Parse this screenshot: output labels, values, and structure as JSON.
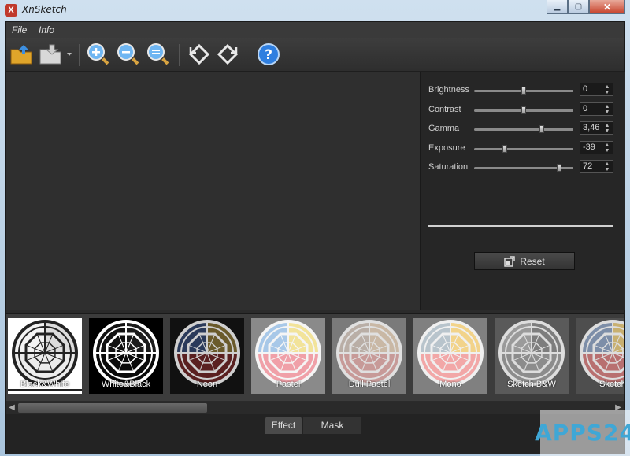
{
  "window": {
    "title": "XnSketch",
    "app_icon": "X"
  },
  "menu": [
    {
      "label": "File"
    },
    {
      "label": "Info"
    }
  ],
  "toolbar": {
    "buttons": [
      {
        "name": "open-icon"
      },
      {
        "name": "save-icon"
      },
      {
        "name": "zoom-in-icon"
      },
      {
        "name": "zoom-out-icon"
      },
      {
        "name": "zoom-fit-icon"
      },
      {
        "name": "rotate-left-icon"
      },
      {
        "name": "rotate-right-icon"
      },
      {
        "name": "help-icon"
      }
    ]
  },
  "adjustments": [
    {
      "label": "Brightness",
      "value": "0",
      "slider": 0.5
    },
    {
      "label": "Contrast",
      "value": "0",
      "slider": 0.5
    },
    {
      "label": "Gamma",
      "value": "3,46",
      "slider": 0.68
    },
    {
      "label": "Exposure",
      "value": "-39",
      "slider": 0.31
    },
    {
      "label": "Saturation",
      "value": "72",
      "slider": 0.86
    }
  ],
  "reset_label": "Reset",
  "effects": [
    {
      "label": "Black&White",
      "bg": "#ffffff",
      "ring": "#222222",
      "q1": "#f2f2f2",
      "q2": "#dcdcdc",
      "q3": "#ececec",
      "selected": true
    },
    {
      "label": "White&Black",
      "bg": "#000000",
      "ring": "#ffffff",
      "q1": "#111111",
      "q2": "#1c1c1c",
      "q3": "#0a0a0a"
    },
    {
      "label": "Neon",
      "bg": "#111111",
      "ring": "#cfcfcf",
      "q1": "#2a3a5a",
      "q2": "#6a5a2a",
      "q3": "#5a2020"
    },
    {
      "label": "Pastel",
      "bg": "#8a8a8a",
      "ring": "#f5f5f5",
      "q1": "#a8c8e8",
      "q2": "#f2e39a",
      "q3": "#f0a0a8"
    },
    {
      "label": "Dull Pastel",
      "bg": "#7a7a7a",
      "ring": "#e0e0e0",
      "q1": "#b9aea6",
      "q2": "#c9b8a5",
      "q3": "#c79a98"
    },
    {
      "label": "Mono",
      "bg": "#808080",
      "ring": "#f0f0f0",
      "q1": "#b8c4cc",
      "q2": "#f2d38a",
      "q3": "#f2a7a7"
    },
    {
      "label": "Sketch B&W",
      "bg": "#5a5a5a",
      "ring": "#dddddd",
      "q1": "#9a9a9a",
      "q2": "#7d7d7d",
      "q3": "#8c8c8c"
    },
    {
      "label": "Sketch",
      "bg": "#4e4e4e",
      "ring": "#dddddd",
      "q1": "#7d8ea8",
      "q2": "#c8b070",
      "q3": "#b87070"
    }
  ],
  "tabs": [
    {
      "label": "Effect",
      "active": true
    },
    {
      "label": "Mask",
      "active": false
    }
  ],
  "watermark": "APPS24"
}
